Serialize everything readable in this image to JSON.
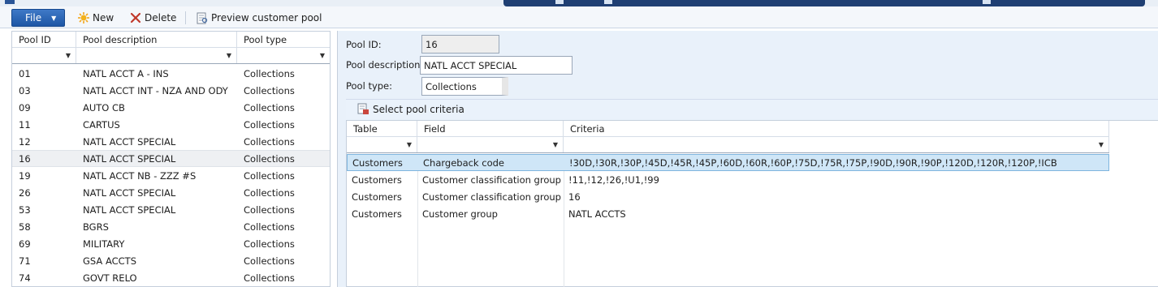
{
  "toolbar": {
    "file_label": "File",
    "new_label": "New",
    "delete_label": "Delete",
    "preview_label": "Preview customer pool"
  },
  "pool_grid": {
    "headers": [
      "Pool ID",
      "Pool description",
      "Pool type"
    ],
    "rows": [
      {
        "id": "01",
        "description": "NATL ACCT A - INS",
        "type": "Collections"
      },
      {
        "id": "03",
        "description": "NATL ACCT INT - NZA AND ODY",
        "type": "Collections"
      },
      {
        "id": "09",
        "description": "AUTO CB",
        "type": "Collections"
      },
      {
        "id": "11",
        "description": "CARTUS",
        "type": "Collections"
      },
      {
        "id": "12",
        "description": "NATL ACCT SPECIAL",
        "type": "Collections"
      },
      {
        "id": "16",
        "description": "NATL ACCT SPECIAL",
        "type": "Collections"
      },
      {
        "id": "19",
        "description": "NATL ACCT NB - ZZZ #S",
        "type": "Collections"
      },
      {
        "id": "26",
        "description": "NATL ACCT SPECIAL",
        "type": "Collections"
      },
      {
        "id": "53",
        "description": "NATL ACCT SPECIAL",
        "type": "Collections"
      },
      {
        "id": "58",
        "description": "BGRS",
        "type": "Collections"
      },
      {
        "id": "69",
        "description": "MILITARY",
        "type": "Collections"
      },
      {
        "id": "71",
        "description": "GSA ACCTS",
        "type": "Collections"
      },
      {
        "id": "74",
        "description": "GOVT RELO",
        "type": "Collections"
      }
    ],
    "selected_index": 5
  },
  "detail": {
    "pool_id_label": "Pool ID:",
    "pool_id_value": "16",
    "pool_desc_label": "Pool description:",
    "pool_desc_value": "NATL ACCT SPECIAL",
    "pool_type_label": "Pool type:",
    "pool_type_value": "Collections",
    "select_criteria_label": "Select pool criteria"
  },
  "criteria_grid": {
    "headers": [
      "Table",
      "Field",
      "Criteria"
    ],
    "rows": [
      {
        "table": "Customers",
        "field": "Chargeback code",
        "criteria": "!30D,!30R,!30P,!45D,!45R,!45P,!60D,!60R,!60P,!75D,!75R,!75P,!90D,!90R,!90P,!120D,!120R,!120P,!ICB"
      },
      {
        "table": "Customers",
        "field": "Customer classification group",
        "criteria": "!11,!12,!26,!U1,!99"
      },
      {
        "table": "Customers",
        "field": "Customer classification group",
        "criteria": "16"
      },
      {
        "table": "Customers",
        "field": "Customer group",
        "criteria": "NATL ACCTS"
      }
    ],
    "selected_index": 0
  },
  "colors": {
    "accent": "#1d56a5",
    "panel_bg": "#e9f1fa",
    "selected_row": "#cfe6f7"
  }
}
